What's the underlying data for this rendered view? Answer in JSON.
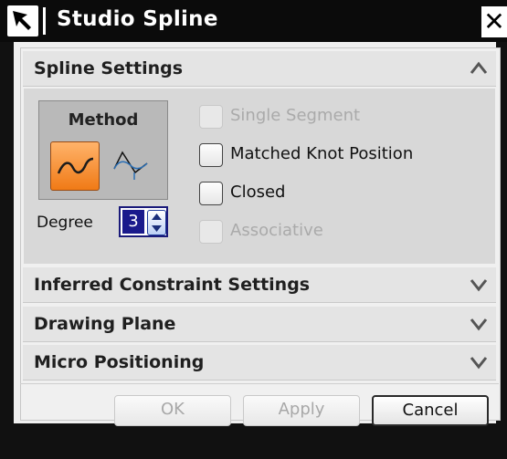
{
  "window": {
    "title": "Studio Spline",
    "close_glyph": "✕",
    "arrow_icon": "select-arrow-icon"
  },
  "sections": [
    {
      "title": "Spline Settings",
      "state": "expanded",
      "chevron": "chevron-up-icon"
    },
    {
      "title": "Inferred Constraint Settings",
      "state": "collapsed",
      "chevron": "chevron-down-icon"
    },
    {
      "title": "Drawing Plane",
      "state": "collapsed",
      "chevron": "chevron-down-icon"
    },
    {
      "title": "Micro Positioning",
      "state": "collapsed",
      "chevron": "chevron-down-icon"
    }
  ],
  "spline_settings": {
    "method_label": "Method",
    "method_options": [
      {
        "icon": "through-points-spline-icon",
        "selected": true
      },
      {
        "icon": "poles-spline-icon",
        "selected": false
      }
    ],
    "degree_label": "Degree",
    "degree_value": "3",
    "checkboxes": [
      {
        "label": "Single Segment",
        "checked": false,
        "enabled": false
      },
      {
        "label": "Matched Knot Position",
        "checked": false,
        "enabled": true
      },
      {
        "label": "Closed",
        "checked": false,
        "enabled": true
      },
      {
        "label": "Associative",
        "checked": false,
        "enabled": false
      }
    ]
  },
  "buttons": {
    "ok": "OK",
    "apply": "Apply",
    "cancel": "Cancel"
  },
  "colors": {
    "selected_method_orange": "#f07a16",
    "title_bar": "#0b0b0b",
    "spinner_highlight": "#1a1a8c"
  }
}
